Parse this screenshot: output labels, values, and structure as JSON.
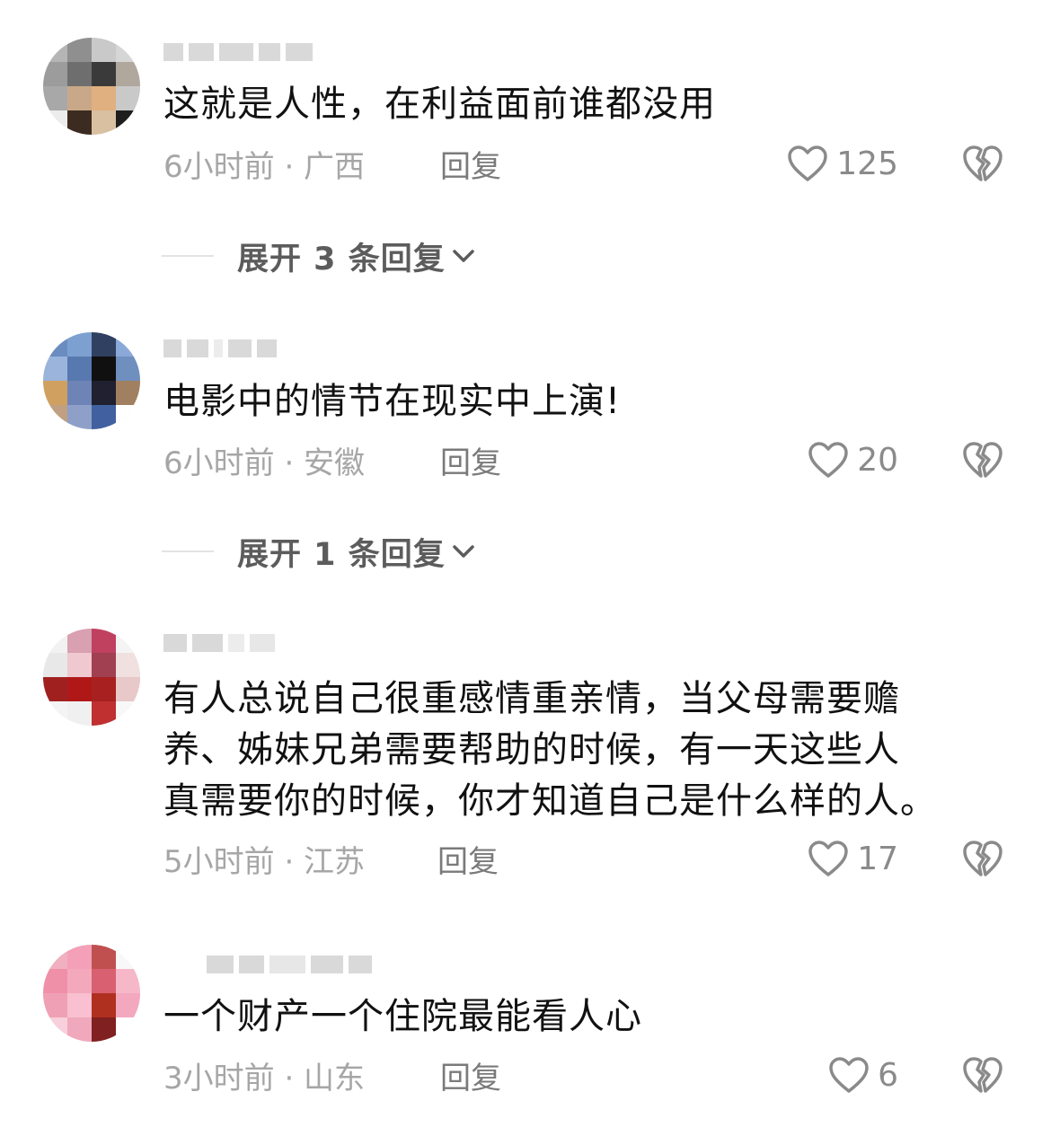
{
  "comments": [
    {
      "text": "这就是人性，在利益面前谁都没用",
      "time": "6小时前 · 广西",
      "reply": "回复",
      "likes": "125",
      "expand": "展开 3 条回复"
    },
    {
      "text": "电影中的情节在现实中上演!",
      "time": "6小时前 · 安徽",
      "reply": "回复",
      "likes": "20",
      "expand": "展开 1 条回复"
    },
    {
      "text": "有人总说自己很重感情重亲情，当父母需要赡\n养、姊妹兄弟需要帮助的时候，有一天这些人\n真需要你的时候，你才知道自己是什么样的人。",
      "time": "5小时前 · 江苏",
      "reply": "回复",
      "likes": "17"
    },
    {
      "text": "一个财产一个住院最能看人心",
      "time": "3小时前 · 山东",
      "reply": "回复",
      "likes": "6"
    }
  ],
  "icons": {
    "like": "heart-outline-icon",
    "dislike": "broken-heart-icon",
    "expand": "chevron-down-icon"
  },
  "colors": {
    "text": "#111111",
    "meta": "#a6a6a6",
    "reply": "#7a7a7a",
    "expand": "#5c5c5c"
  }
}
